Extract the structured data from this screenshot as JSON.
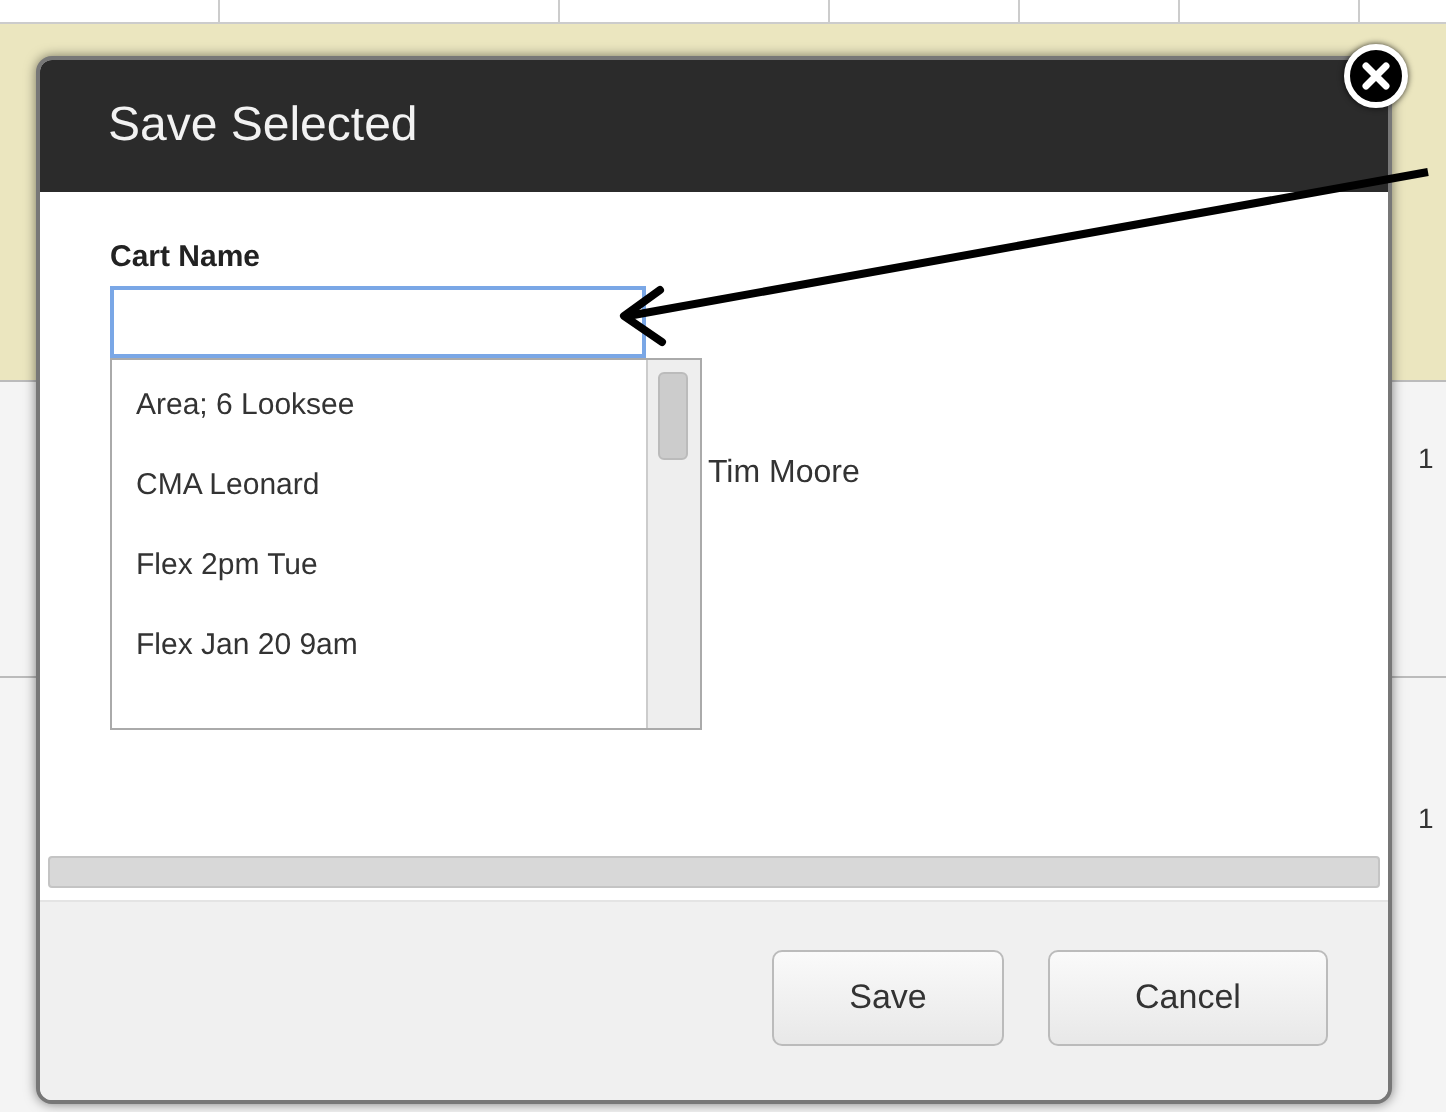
{
  "background": {
    "row_numbers": [
      "1",
      "1"
    ]
  },
  "dialog": {
    "title": "Save Selected",
    "field": {
      "label": "Cart Name",
      "focused": true
    },
    "suggestions": [
      "Area; 6 Looksee",
      "CMA Leonard",
      "Flex 2pm Tue",
      "Flex Jan 20 9am"
    ],
    "side_text": "Tim Moore",
    "buttons": [
      "Save",
      "Cancel"
    ]
  }
}
